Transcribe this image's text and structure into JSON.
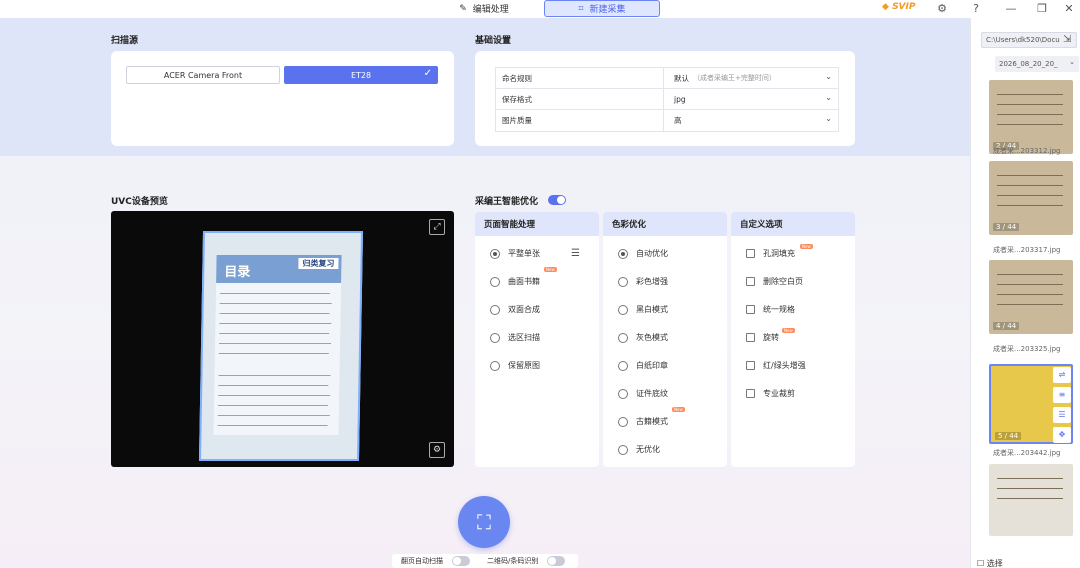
{
  "topbar": {
    "tab_edit": "编辑处理",
    "tab_new": "新建采集",
    "svip": "SVIP",
    "icons": [
      "svip-icon",
      "settings-icon",
      "help-icon",
      "minimize-icon",
      "restore-icon",
      "close-icon"
    ]
  },
  "scan_source": {
    "title": "扫描源",
    "options": [
      "ACER Camera Front",
      "ET28"
    ],
    "selected": "ET28"
  },
  "basic_settings": {
    "title": "基础设置",
    "rows": [
      {
        "label": "命名规则",
        "value": "默认",
        "hint": "（成者采编王+完整时间）"
      },
      {
        "label": "保存格式",
        "value": "jpg",
        "hint": ""
      },
      {
        "label": "图片质量",
        "value": "高",
        "hint": ""
      }
    ]
  },
  "preview": {
    "title": "UVC设备预览",
    "doc_title": "目录",
    "doc_tag": "归类复习"
  },
  "smart": {
    "title": "采编王智能优化",
    "enabled": true,
    "page_col": {
      "title": "页面智能处理",
      "options": [
        "平整单张",
        "曲面书籍",
        "双面合成",
        "选区扫描",
        "保留原图"
      ],
      "selected": 0
    },
    "color_col": {
      "title": "色彩优化",
      "options": [
        "自动优化",
        "彩色增强",
        "黑白模式",
        "灰色模式",
        "白纸印章",
        "证件底纹",
        "古籍模式",
        "无优化"
      ],
      "selected": 0
    },
    "custom_col": {
      "title": "自定义选项",
      "options": [
        "孔洞填充",
        "删除空白页",
        "统一规格",
        "旋转",
        "红/绿头增强",
        "专业裁剪"
      ]
    }
  },
  "bottom": {
    "auto_turn": "翻页自动扫描",
    "barcode": "二维码/条码识别"
  },
  "sidebar": {
    "path": "C:\\Users\\dk520\\Docu",
    "date": "2026_08_20_20_",
    "thumbs": [
      {
        "page": "2 / 44",
        "caption": "成者采...203312.jpg"
      },
      {
        "page": "3 / 44",
        "caption": "成者采...203317.jpg"
      },
      {
        "page": "4 / 44",
        "caption": "成者采...203325.jpg"
      },
      {
        "page": "5 / 44",
        "caption": "成者采...203442.jpg"
      }
    ],
    "select_label": "选择"
  }
}
